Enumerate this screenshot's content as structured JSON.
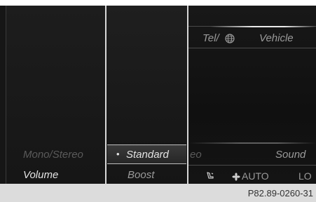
{
  "column1": {
    "mono_stereo": "Mono/Stereo",
    "volume": "Volume"
  },
  "column2": {
    "selected_bullet": "•",
    "standard": "Standard",
    "boost": "Boost"
  },
  "column3": {
    "tel_label": "Tel/",
    "vehicle": "Vehicle",
    "eo_fragment": "eo",
    "sound": "Sound",
    "auto": "AUTO",
    "lo": "LO"
  },
  "icons": [
    "globe-icon",
    "seat-icon",
    "fan-icon"
  ],
  "footer": {
    "code": "P82.89-0260-31"
  }
}
